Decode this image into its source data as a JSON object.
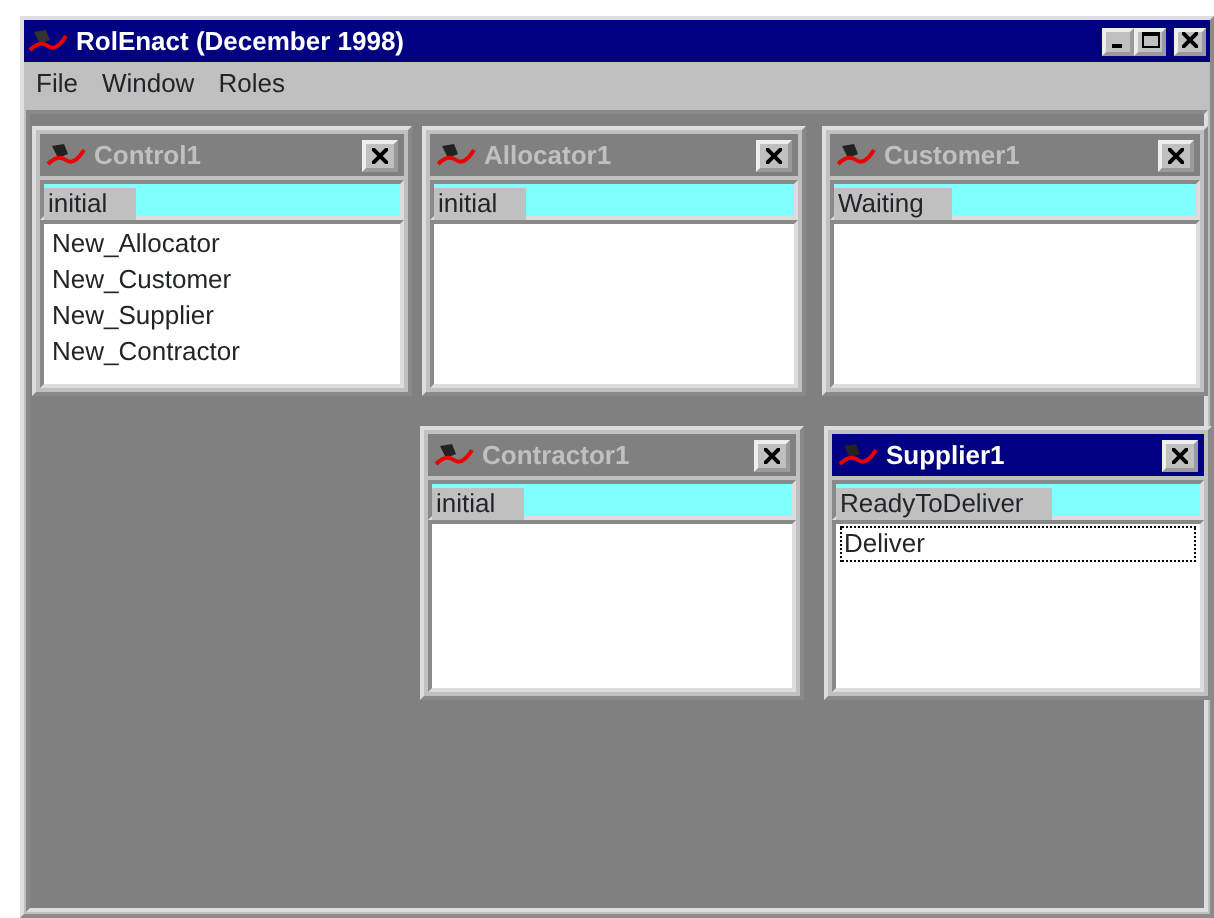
{
  "window": {
    "title": "RolEnact (December 1998)"
  },
  "menu": [
    "File",
    "Window",
    "Roles"
  ],
  "children": [
    {
      "title": "Control1",
      "active": false,
      "state": "initial",
      "actions": [
        {
          "label": "New_Allocator",
          "focused": false
        },
        {
          "label": "New_Customer",
          "focused": false
        },
        {
          "label": "New_Supplier",
          "focused": false
        },
        {
          "label": "New_Contractor",
          "focused": false
        }
      ]
    },
    {
      "title": "Allocator1",
      "active": false,
      "state": "initial"
    },
    {
      "title": "Customer1",
      "active": false,
      "state": "Waiting"
    },
    {
      "title": "Contractor1",
      "active": false,
      "state": "initial"
    },
    {
      "title": "Supplier1",
      "active": true,
      "state": "ReadyToDeliver",
      "actions": [
        {
          "label": "Deliver",
          "focused": true
        }
      ]
    }
  ]
}
